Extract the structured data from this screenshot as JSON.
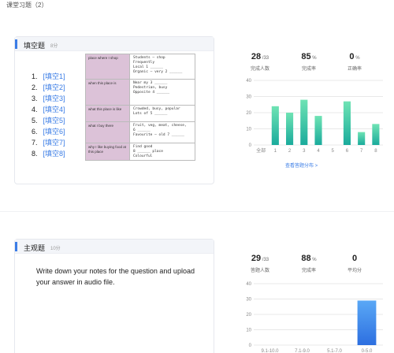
{
  "page_title": "课堂习题（2）",
  "q1": {
    "name": "填空题",
    "score": "8分",
    "blanks": [
      {
        "num": "1.",
        "label": "[填空1]"
      },
      {
        "num": "2.",
        "label": "[填空2]"
      },
      {
        "num": "3.",
        "label": "[填空3]"
      },
      {
        "num": "4.",
        "label": "[填空4]"
      },
      {
        "num": "5.",
        "label": "[填空5]"
      },
      {
        "num": "6.",
        "label": "[填空6]"
      },
      {
        "num": "7.",
        "label": "[填空7]"
      },
      {
        "num": "8.",
        "label": "[填空8]"
      }
    ],
    "worksheet": [
      {
        "left": "place where I shop",
        "right": [
          "Students – shop",
          "Frequently",
          "Local 1 ______",
          "Organic – very 2 ______"
        ]
      },
      {
        "left": "when this place is",
        "right": [
          "Near my 3 ______",
          "Pedestrian, busy",
          "Opposite 4 ______"
        ]
      },
      {
        "left": "what this place is like",
        "right": [
          "Crowded, busy, popular",
          "Lots of 5 ______"
        ]
      },
      {
        "left": "what I buy there",
        "right": [
          "Fruit, veg, meat, cheese,",
          "6 ______",
          "Favourite – old 7 ______"
        ]
      },
      {
        "left": "why I like buying food at this place",
        "right": [
          "Find good",
          "8 ______ place",
          "Colourful"
        ]
      }
    ],
    "stats": [
      {
        "value": "28",
        "unit": " /33",
        "label": "完成人数"
      },
      {
        "value": "85",
        "unit": " %",
        "label": "完成率"
      },
      {
        "value": "0",
        "unit": " %",
        "label": "正确率"
      }
    ],
    "link": "查看答题分布 >",
    "chart_data": {
      "type": "bar",
      "categories": [
        "全部",
        "1",
        "2",
        "3",
        "4",
        "5",
        "6",
        "7",
        "8"
      ],
      "values": [
        0,
        24,
        20,
        28,
        18,
        0,
        27,
        8,
        13
      ],
      "ylim": [
        0,
        40
      ],
      "yticks": [
        "0",
        "10",
        "20",
        "30",
        "40"
      ],
      "grid": true
    },
    "colors": {
      "bar_top": "#6fe3b4",
      "bar_bottom": "#1aab9c"
    }
  },
  "q2": {
    "name": "主观题",
    "score": "10分",
    "prompt": "Write down your notes for the question and upload your answer in audio file.",
    "stats": [
      {
        "value": "29",
        "unit": " /33",
        "label": "答题人数"
      },
      {
        "value": "88",
        "unit": " %",
        "label": "完成率"
      },
      {
        "value": "0",
        "unit": "",
        "label": "平均分"
      }
    ],
    "chart_data": {
      "type": "bar",
      "categories": [
        "9.1-10.0",
        "7.1-9.0",
        "5.1-7.0",
        "0-5.0"
      ],
      "values": [
        0,
        0,
        0,
        29
      ],
      "ylim": [
        0,
        40
      ],
      "yticks": [
        "0",
        "10",
        "20",
        "30",
        "40"
      ],
      "grid": true
    },
    "colors": {
      "bar_top": "#5aa8f6",
      "bar_bottom": "#2d6fe0"
    }
  }
}
